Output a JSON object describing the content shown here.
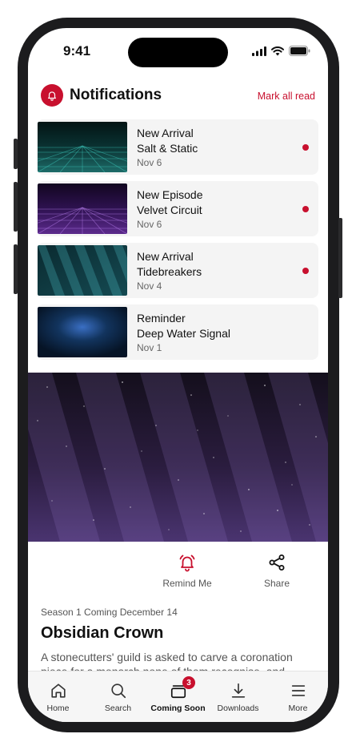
{
  "status_bar": {
    "time": "9:41"
  },
  "notifications": {
    "title": "Notifications",
    "mark_all_read": "Mark all read",
    "items": [
      {
        "kind": "New Arrival",
        "show": "Salt & Static",
        "date": "Nov 6",
        "unread": true,
        "thumb": "teal-grid"
      },
      {
        "kind": "New Episode",
        "show": "Velvet Circuit",
        "date": "Nov 6",
        "unread": true,
        "thumb": "purple-grid"
      },
      {
        "kind": "New Arrival",
        "show": "Tidebreakers",
        "date": "Nov 4",
        "unread": true,
        "thumb": "teal-rays"
      },
      {
        "kind": "Reminder",
        "show": "Deep Water Signal",
        "date": "Nov 1",
        "unread": false,
        "thumb": "blue-glow"
      }
    ]
  },
  "featured": {
    "actions": {
      "remind": "Remind Me",
      "share": "Share"
    },
    "season": "Season 1 Coming December 14",
    "title": "Obsidian Crown",
    "synopsis": "A stonecutters' guild is asked to carve a coronation piece for a monarch none of them recognise, and"
  },
  "tabbar": {
    "items": [
      {
        "label": "Home",
        "icon": "home-icon"
      },
      {
        "label": "Search",
        "icon": "search-icon"
      },
      {
        "label": "Coming Soon",
        "icon": "coming-soon-icon",
        "badge": "3",
        "active": true
      },
      {
        "label": "Downloads",
        "icon": "download-icon"
      },
      {
        "label": "More",
        "icon": "menu-icon"
      }
    ]
  },
  "colors": {
    "accent": "#c8102e"
  }
}
